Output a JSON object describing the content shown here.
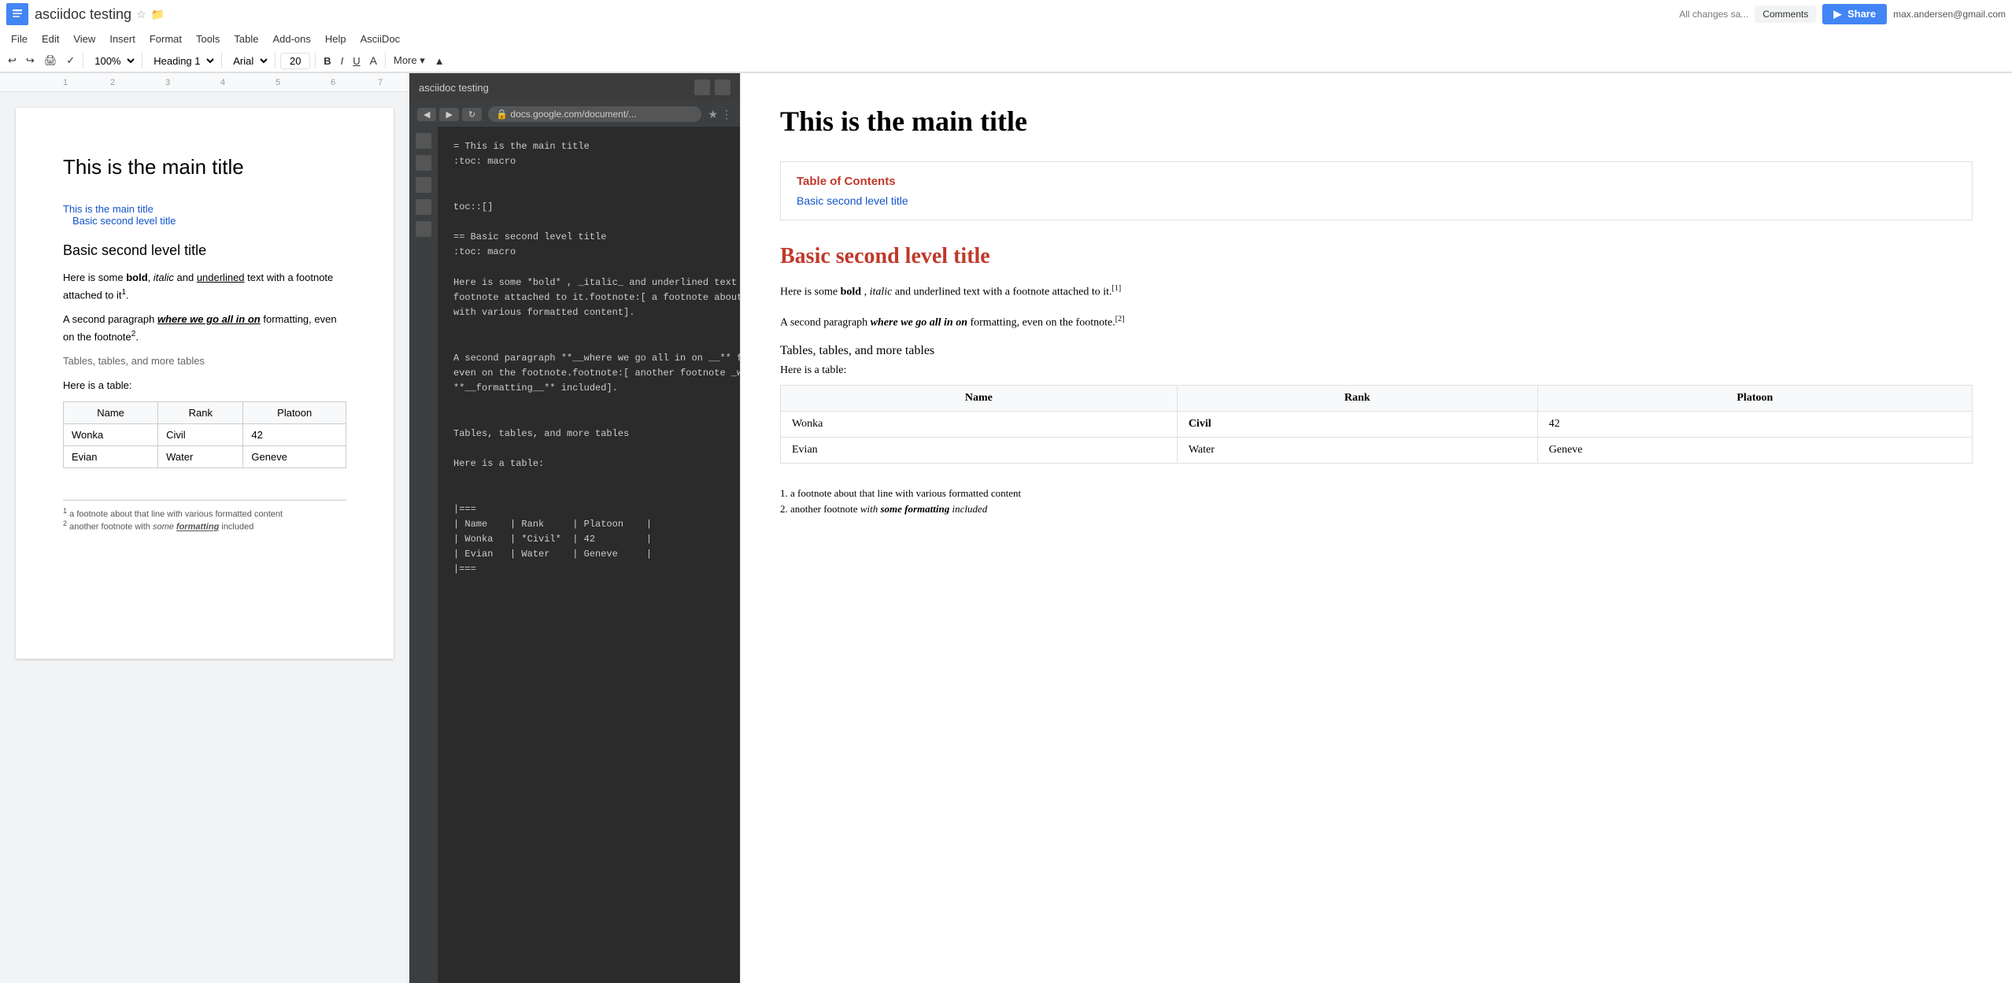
{
  "app": {
    "title": "asciidoc testing",
    "icon_char": "≡"
  },
  "topbar": {
    "user_email": "max.andersen@gmail.com",
    "comments_label": "Comments",
    "share_label": "Share",
    "autosave": "All changes sa...",
    "menu_items": [
      "File",
      "Edit",
      "View",
      "Insert",
      "Format",
      "Tools",
      "Table",
      "Add-ons",
      "Help",
      "AsciiDoc"
    ]
  },
  "toolbar": {
    "zoom": "100%",
    "heading": "Heading 1",
    "font": "Arial",
    "font_size": "20",
    "more_label": "More"
  },
  "doc": {
    "main_title": "This is the main title",
    "toc_links": [
      "This is the main title",
      "Basic second level title"
    ],
    "section_title": "Basic second level title",
    "para1_prefix": "Here is some ",
    "para1_bold": "bold",
    "para1_middle": ", ",
    "para1_italic": "italic",
    "para1_suffix": " and ",
    "para1_underline": "underlined",
    "para1_end": " text with a footnote attached to it",
    "para1_footnote_ref": "1",
    "para2_prefix": "A second paragraph ",
    "para2_bold_italic_underline": "where we go all in on",
    "para2_suffix": " formatting, even on the footnote",
    "para2_footnote_ref": "2",
    "tables_heading": "Tables, tables, and more tables",
    "here_table": "Here is a table:",
    "table_headers": [
      "Name",
      "Rank",
      "Platoon"
    ],
    "table_rows": [
      [
        "Wonka",
        "Civil",
        "42"
      ],
      [
        "Evian",
        "Water",
        "Geneve"
      ]
    ],
    "footnote1": "a footnote about that line with various formatted content",
    "footnote2": "another footnote with ",
    "footnote2_italic": "some ",
    "footnote2_bold_italic": "formatting",
    "footnote2_end": " included"
  },
  "preview": {
    "main_title": "This is the main title",
    "toc_title": "Table of Contents",
    "toc_links": [
      "Basic second level title"
    ],
    "section_title": "Basic second level title",
    "para1": "Here is some bold , italic and underlined text with a footnote attached to it.",
    "para2_prefix": "A second paragraph ",
    "para2_italic": "where we go all in on",
    "para2_suffix": " formatting, even on the footnote.",
    "tables_heading": "Tables, tables, and more tables",
    "here_table": "Here is a table:",
    "table_headers": [
      "Name",
      "Rank",
      "Platoon"
    ],
    "table_rows": [
      [
        "Wonka",
        "Civil",
        "42"
      ],
      [
        "Evian",
        "Water",
        "Geneve"
      ]
    ],
    "footnote1_num": "1.",
    "footnote1": "a footnote about that line with various formatted content",
    "footnote2_num": "2.",
    "footnote2": "another footnote with some formatting included"
  },
  "code": {
    "content": "= This is the main title\n:toc: macro\n\n\ntoc::[]\n\n== Basic second level title\n:toc: macro\n\nHere is some *bold* , _italic_ and underlined text with a\nfootnote attached to it.footnote:[ a footnote about that line\nwith various formatted content].\n\n\nA second paragraph **__where we go all in on __** formatting,\neven on the footnote.footnote:[ another footnote _with_ *some*\n**__formatting__** included].\n\n\nTables, tables, and more tables\n\nHere is a table:\n\n\n|===\n| Name    | Rank     | Platoon    |\n| Wonka   | *Civil*  | 42         |\n| Evian   | Water    | Geneve     |\n|==="
  },
  "colors": {
    "blue_link": "#1155cc",
    "red_section": "#c0392b",
    "toc_red": "#c0392b",
    "google_blue": "#4285f4"
  }
}
